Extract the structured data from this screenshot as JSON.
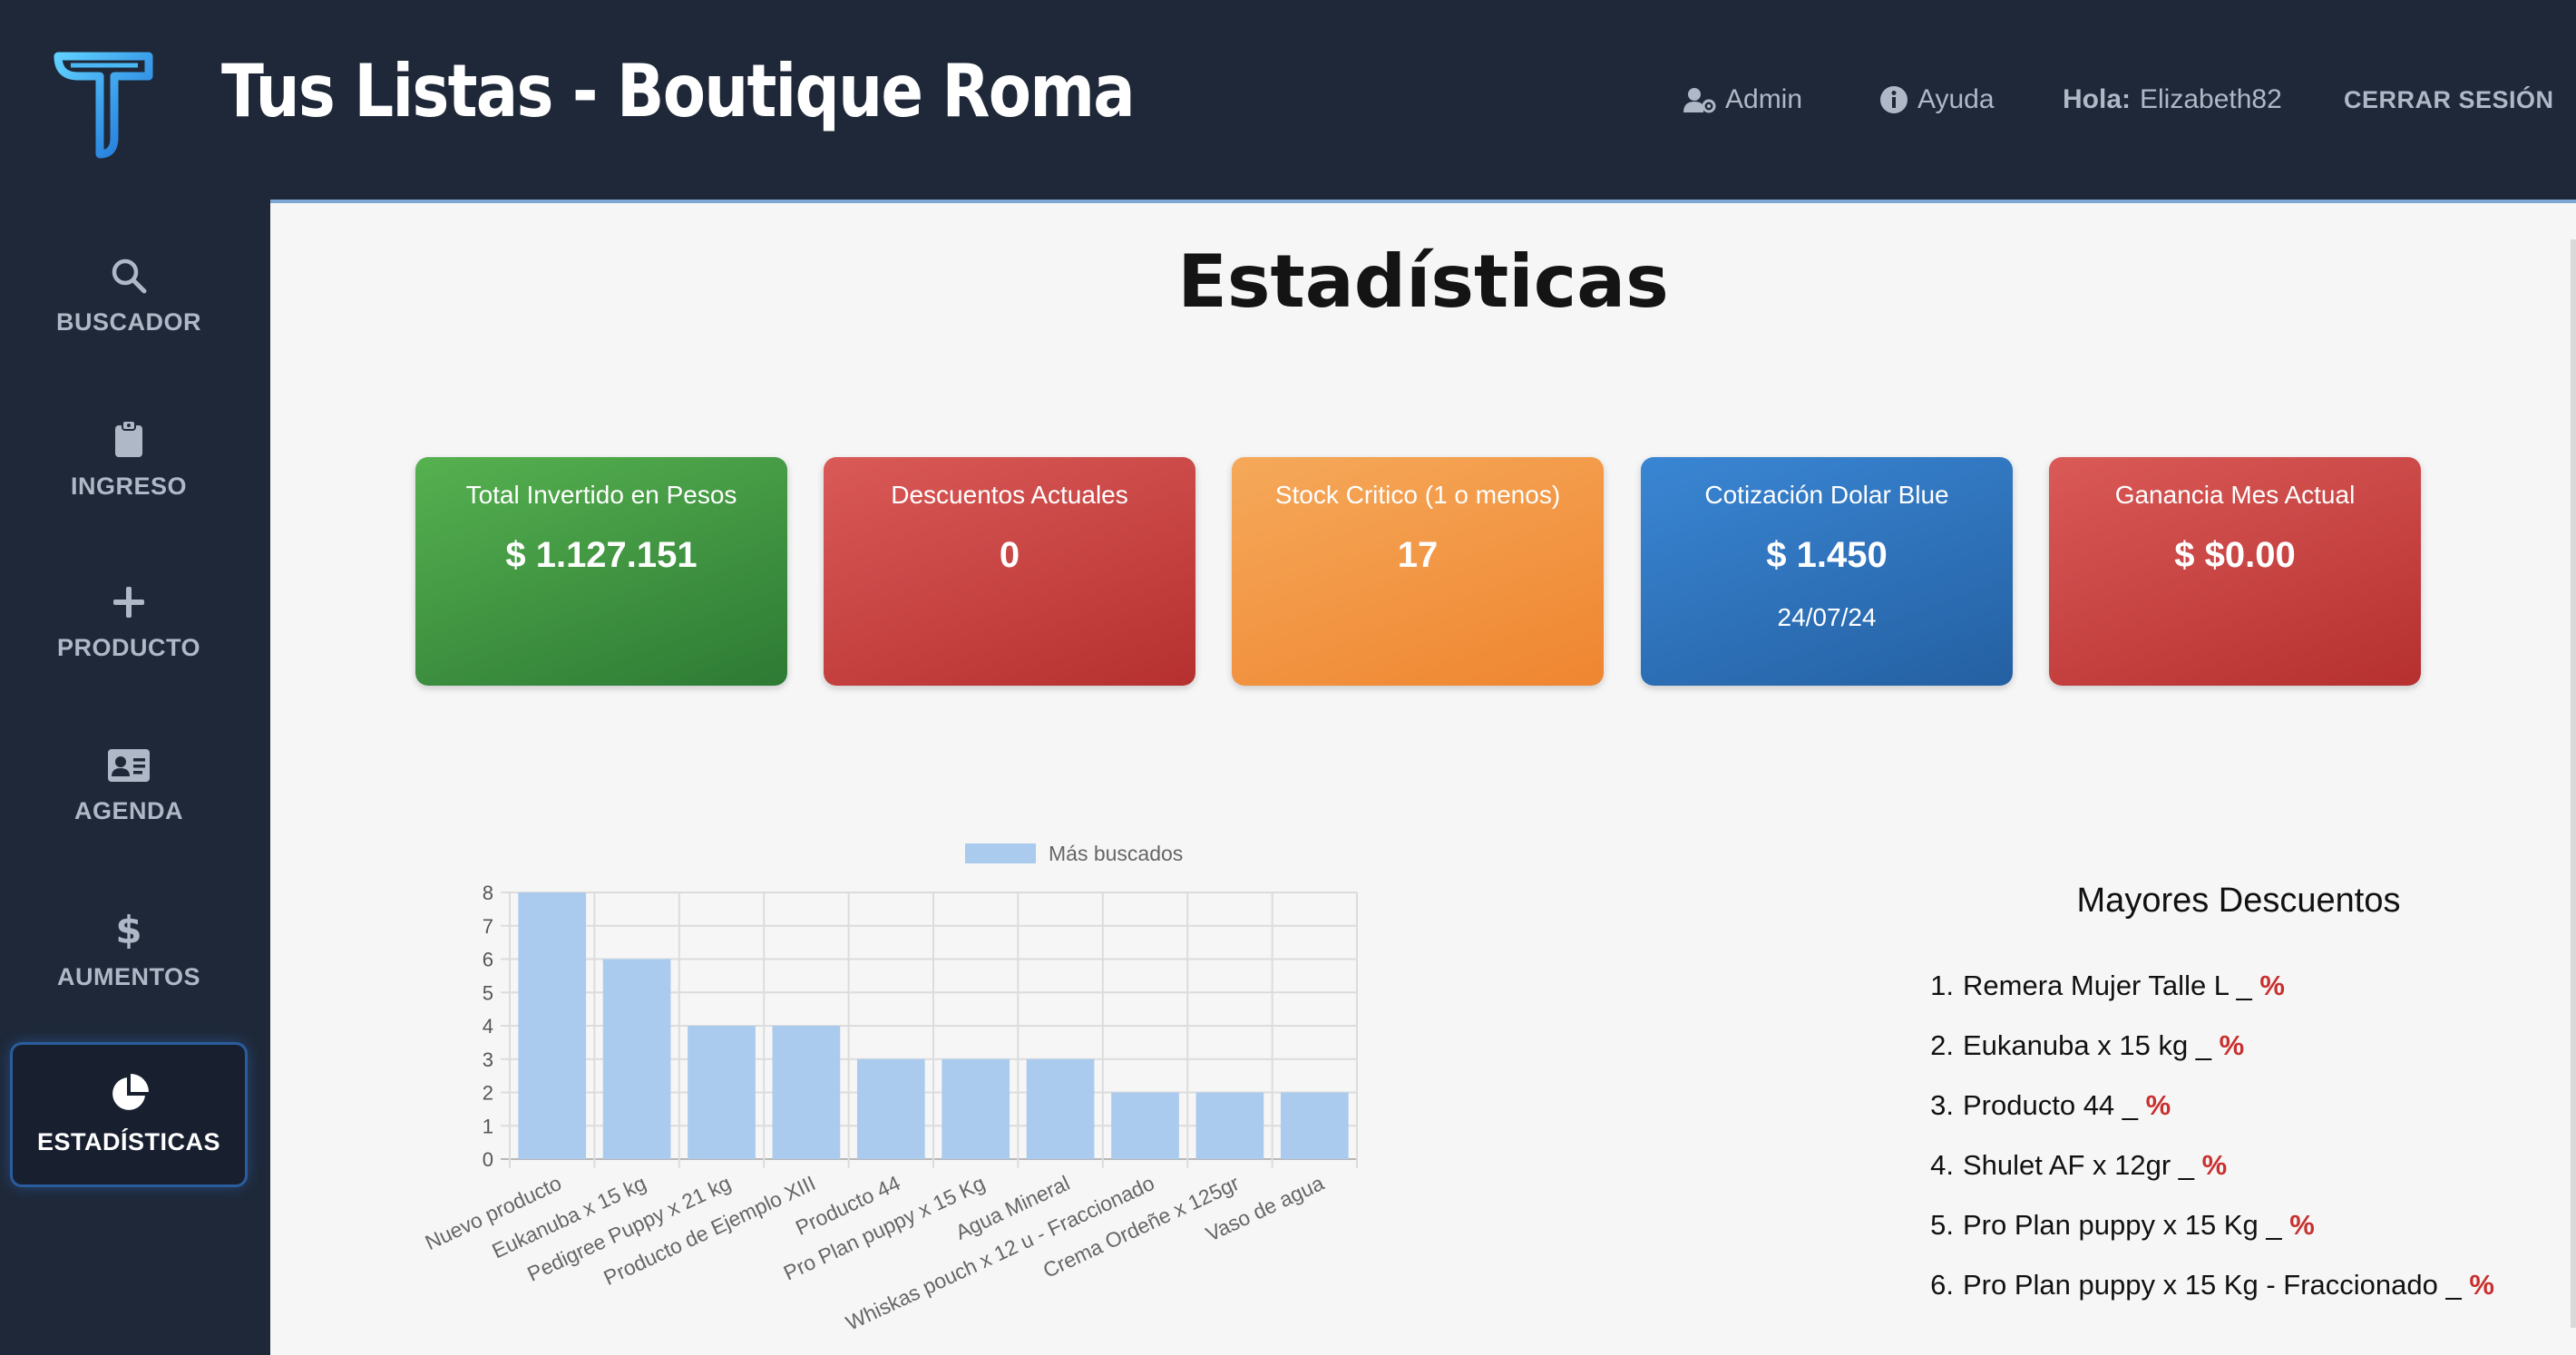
{
  "header": {
    "title": "Tus Listas - Boutique Roma",
    "admin": "Admin",
    "help": "Ayuda",
    "hello_label": "Hola:",
    "username": "Elizabeth82",
    "logout": "CERRAR SESIÓN"
  },
  "sidebar": {
    "items": [
      {
        "label": "BUSCADOR",
        "icon": "search-icon"
      },
      {
        "label": "INGRESO",
        "icon": "clipboard-icon"
      },
      {
        "label": "PRODUCTO",
        "icon": "plus-icon"
      },
      {
        "label": "AGENDA",
        "icon": "contact-card-icon"
      },
      {
        "label": "AUMENTOS",
        "icon": "dollar-icon"
      },
      {
        "label": "ESTADÍSTICAS",
        "icon": "pie-chart-icon",
        "active": true
      }
    ]
  },
  "main": {
    "title": "Estadísticas",
    "cards": [
      {
        "label": "Total Invertido en Pesos",
        "value": "$ 1.127.151",
        "color": "#3f9443"
      },
      {
        "label": "Descuentos Actuales",
        "value": "0",
        "color": "#c94341"
      },
      {
        "label": "Stock Critico (1 o menos)",
        "value": "17",
        "color": "#f29744"
      },
      {
        "label": "Cotización Dolar Blue",
        "value": "$ 1.450",
        "sub": "24/07/24",
        "color": "#2f73bb"
      },
      {
        "label": "Ganancia Mes Actual",
        "value": "$ $0.00",
        "color": "#c94341"
      }
    ],
    "discounts": {
      "title": "Mayores Descuentos",
      "items": [
        {
          "n": "1.",
          "name": "Remera Mujer Talle L _ ",
          "pct": "%"
        },
        {
          "n": "2.",
          "name": "Eukanuba x 15 kg _ ",
          "pct": "%"
        },
        {
          "n": "3.",
          "name": "Producto 44 _ ",
          "pct": "%"
        },
        {
          "n": "4.",
          "name": "Shulet AF x 12gr _ ",
          "pct": "%"
        },
        {
          "n": "5.",
          "name": "Pro Plan puppy x 15 Kg _ ",
          "pct": "%"
        },
        {
          "n": "6.",
          "name": "Pro Plan puppy x 15 Kg - Fraccionado _ ",
          "pct": "%"
        }
      ]
    }
  },
  "colors": {
    "sidebar_bg": "#1e2838",
    "main_bg": "#f6f6f6",
    "bar_fill": "#aacbee",
    "accent_red": "#c8302f"
  },
  "chart_data": {
    "type": "bar",
    "categories": [
      "Nuevo producto",
      "Eukanuba x 15 kg",
      "Pedigree Puppy x 21 kg",
      "Producto de Ejemplo XIII",
      "Producto 44",
      "Pro Plan puppy x 15 Kg",
      "Agua Mineral",
      "Whiskas pouch x 12 u - Fraccionado",
      "Crema Ordeñe x 125gr",
      "Vaso de agua"
    ],
    "series": [
      {
        "name": "Más buscados",
        "values": [
          8,
          6,
          4,
          4,
          3,
          3,
          3,
          2,
          2,
          2
        ]
      }
    ],
    "yticks": [
      "0",
      "1",
      "2",
      "3",
      "4",
      "5",
      "6",
      "7",
      "8"
    ],
    "ylim": [
      0,
      8
    ],
    "legend": "top",
    "grid": true
  }
}
